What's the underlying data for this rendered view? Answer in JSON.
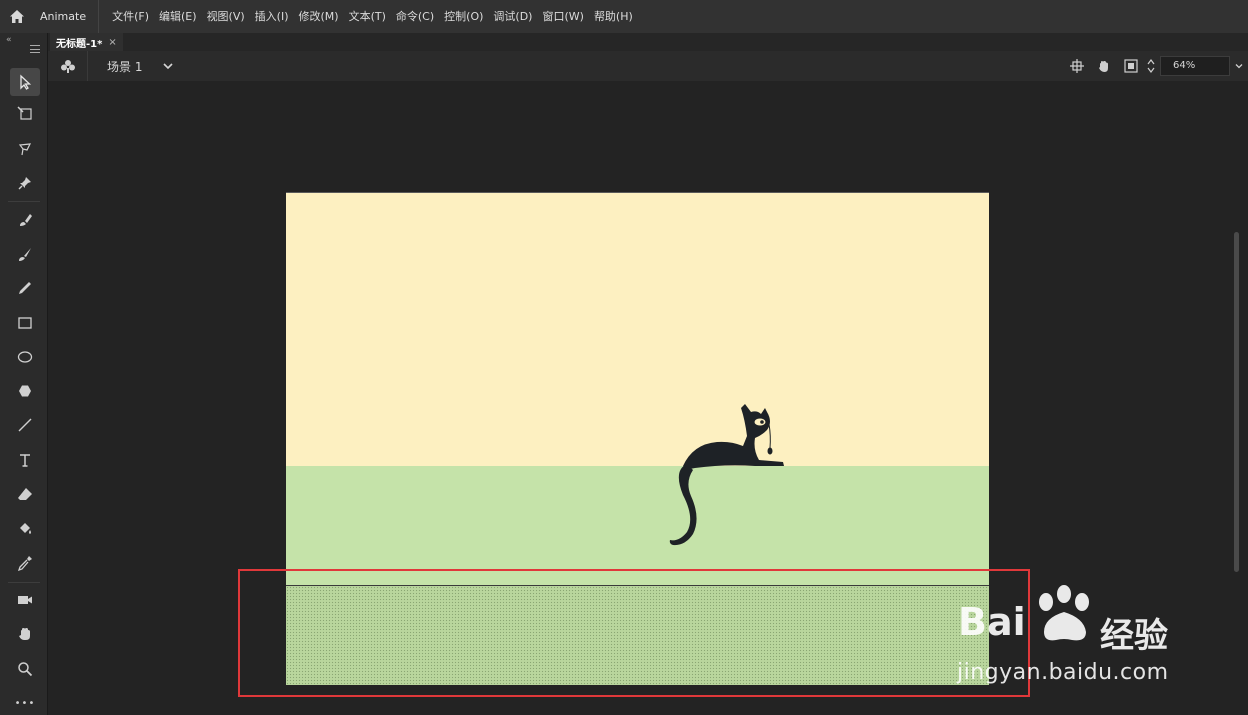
{
  "app": {
    "name": "Animate"
  },
  "menu": [
    "文件(F)",
    "编辑(E)",
    "视图(V)",
    "插入(I)",
    "修改(M)",
    "文本(T)",
    "命令(C)",
    "控制(O)",
    "调试(D)",
    "窗口(W)",
    "帮助(H)"
  ],
  "document": {
    "tab_title": "无标题-1*",
    "close_glyph": "×"
  },
  "scene": {
    "label": "场景 1"
  },
  "zoom": {
    "value": "64%"
  },
  "tools": [
    {
      "name": "selection-tool-icon",
      "active": true
    },
    {
      "name": "free-transform-tool-icon"
    },
    {
      "name": "lasso-tool-icon"
    },
    {
      "name": "pin-tool-icon"
    },
    {
      "name": "paint-brush-tool-icon"
    },
    {
      "name": "brush-tool-icon"
    },
    {
      "name": "pencil-tool-icon"
    },
    {
      "name": "rectangle-tool-icon"
    },
    {
      "name": "oval-tool-icon"
    },
    {
      "name": "polystar-tool-icon"
    },
    {
      "name": "line-tool-icon"
    },
    {
      "name": "text-tool-icon"
    },
    {
      "name": "eraser-tool-icon"
    },
    {
      "name": "paint-bucket-tool-icon"
    },
    {
      "name": "eyedropper-tool-icon"
    },
    {
      "name": "camera-tool-icon"
    },
    {
      "name": "hand-tool-icon"
    },
    {
      "name": "zoom-tool-icon"
    }
  ],
  "toolbar_more": "•••",
  "watermark": {
    "brand_latin": "Bai",
    "brand_cn": "经验",
    "url": "jingyan.baidu.com"
  },
  "colors": {
    "sky": "#fdf0c1",
    "ground": "#c5e3a9",
    "highlight": "#e0383a",
    "cat": "#1e2226"
  }
}
